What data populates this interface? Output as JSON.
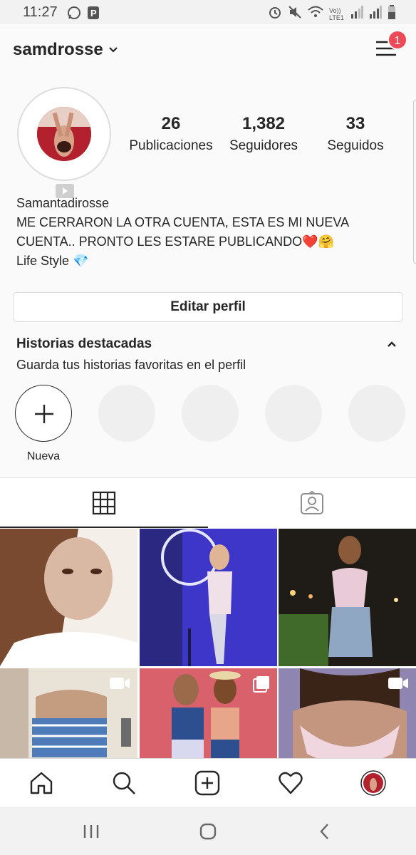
{
  "status_bar": {
    "time": "11:27",
    "network_label": "Vo)) LTE1"
  },
  "header": {
    "username": "samdrosse",
    "notification_count": "1"
  },
  "profile": {
    "stats": [
      {
        "value": "26",
        "label": "Publicaciones"
      },
      {
        "value": "1,382",
        "label": "Seguidores"
      },
      {
        "value": "33",
        "label": "Seguidos"
      }
    ],
    "display_name": "Samantadirosse",
    "bio_line1": "ME CERRARON LA OTRA CUENTA, ESTA ES MI NUEVA",
    "bio_line2": "CUENTA.. PRONTO LES ESTARE PUBLICANDO❤️🤗",
    "bio_line3": "Life Style 💎",
    "edit_button": "Editar perfil"
  },
  "highlights": {
    "title": "Historias destacadas",
    "subtitle": "Guarda tus historias favoritas en el perfil",
    "new_label": "Nueva"
  },
  "tabs": [
    {
      "name": "grid",
      "active": true
    },
    {
      "name": "tagged",
      "active": false
    }
  ],
  "posts": [
    {
      "kind": "photo",
      "colors": [
        "#d9b9a4",
        "#7a4a30",
        "#f4efe9"
      ]
    },
    {
      "kind": "photo",
      "colors": [
        "#3d36c9",
        "#2a2880",
        "#d8d8e6"
      ]
    },
    {
      "kind": "photo",
      "colors": [
        "#1f1c18",
        "#e8cbd6",
        "#8fa7c2"
      ]
    },
    {
      "kind": "video",
      "colors": [
        "#c7b8a8",
        "#4f7bb8",
        "#e9e2d6"
      ]
    },
    {
      "kind": "carousel",
      "colors": [
        "#d9616b",
        "#2d4f8f",
        "#e7a58a"
      ]
    },
    {
      "kind": "video",
      "colors": [
        "#8e86b0",
        "#efd6df",
        "#c49680"
      ]
    }
  ],
  "colors": {
    "accent_badge": "#ed4956",
    "text": "#262626",
    "background": "#fafafa"
  }
}
